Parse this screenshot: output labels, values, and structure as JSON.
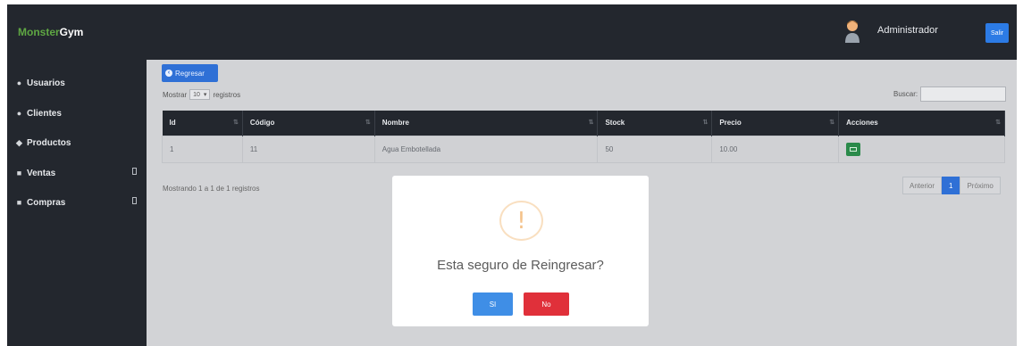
{
  "header": {
    "brand_part1": "Monster",
    "brand_part2": "Gym",
    "user_name": "Administrador",
    "exit_label": "Salir"
  },
  "sidebar": {
    "items": [
      {
        "label": "Usuarios",
        "icon": "user-icon"
      },
      {
        "label": "Clientes",
        "icon": "users-icon"
      },
      {
        "label": "Productos",
        "icon": "tags-icon"
      },
      {
        "label": "Ventas",
        "icon": "cart-icon"
      },
      {
        "label": "Compras",
        "icon": "bag-icon"
      }
    ]
  },
  "main": {
    "back_label": "Regresar",
    "length_prefix": "Mostrar",
    "length_value": "10",
    "length_suffix": "registros",
    "search_label": "Buscar:",
    "columns": [
      "Id",
      "Código",
      "Nombre",
      "Stock",
      "Precio",
      "Acciones"
    ],
    "rows": [
      {
        "id": "1",
        "codigo": "11",
        "nombre": "Agua Embotellada",
        "stock": "50",
        "precio": "10.00"
      }
    ],
    "info": "Mostrando 1 a 1 de 1 registros",
    "pager": {
      "prev": "Anterior",
      "current": "1",
      "next": "Próximo"
    }
  },
  "modal": {
    "icon": "warning-icon",
    "icon_glyph": "!",
    "title": "Esta seguro de Reingresar?",
    "yes_label": "SI",
    "no_label": "No"
  },
  "colors": {
    "accent": "#2f70d6",
    "success": "#2a8a4a",
    "danger": "#e0303a",
    "dark": "#23272e"
  }
}
